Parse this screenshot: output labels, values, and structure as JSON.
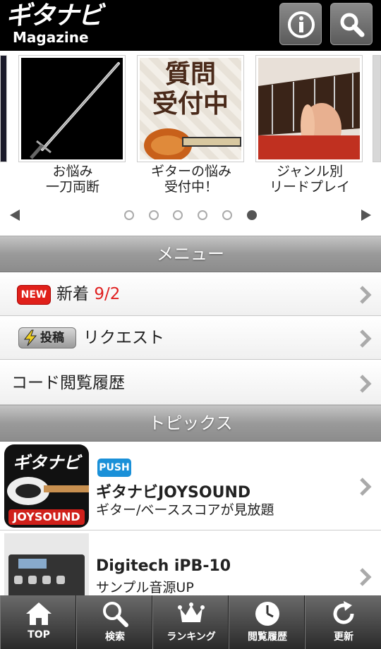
{
  "header": {
    "logo_main": "ギタナビ",
    "logo_sub": "Magazine",
    "info_icon": "info-icon",
    "search_icon": "search-icon"
  },
  "carousel": {
    "items": [
      {
        "caption_line1": "お悩み",
        "caption_line2": "一刀両断"
      },
      {
        "caption_line1": "ギターの悩み",
        "caption_line2": "受付中！",
        "image_text_1": "質問",
        "image_text_2": "受付中"
      },
      {
        "caption_line1": "ジャンル別",
        "caption_line2": "リードプレイ"
      }
    ],
    "dot_count": 6,
    "active_dot": 6
  },
  "menu": {
    "title": "メニュー",
    "items": [
      {
        "badge": "NEW",
        "label": "新着",
        "date": "9/2"
      },
      {
        "badge": "投稿",
        "label": "リクエスト"
      },
      {
        "label": "コード閲覧履歴"
      }
    ]
  },
  "topics": {
    "title": "トピックス",
    "items": [
      {
        "badge": "PUSH",
        "title": "ギタナビJOYSOUND",
        "subtitle": "ギター/ベーススコアが見放題",
        "icon_text_top": "ギタナビ",
        "icon_text_bottom": "JOYSOUND"
      },
      {
        "title": "Digitech iPB-10",
        "subtitle": "サンプル音源UP"
      }
    ]
  },
  "tabbar": {
    "items": [
      {
        "label": "TOP",
        "icon": "home-icon"
      },
      {
        "label": "検索",
        "icon": "search-icon"
      },
      {
        "label": "ランキング",
        "icon": "crown-icon"
      },
      {
        "label": "閲覧履歴",
        "icon": "clock-icon"
      },
      {
        "label": "更新",
        "icon": "refresh-icon"
      }
    ]
  },
  "colors": {
    "header_bg": "#000000",
    "new_badge": "#e0201a",
    "push_badge": "#1a90d8",
    "date_red": "#e02020"
  }
}
